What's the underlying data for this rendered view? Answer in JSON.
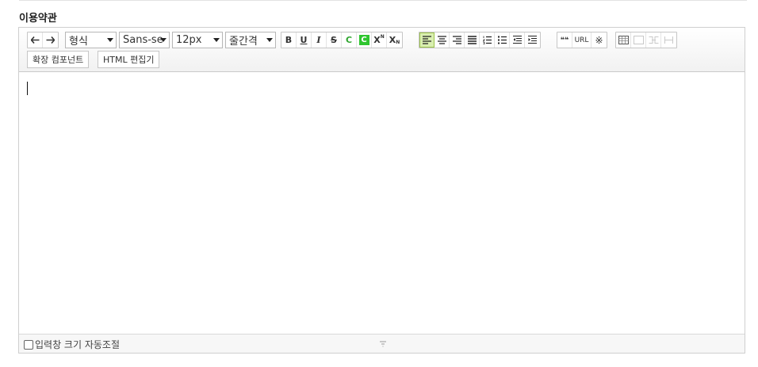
{
  "section": {
    "title": "이용약관"
  },
  "toolbar": {
    "undo_icon": "arrow-left-icon",
    "redo_icon": "arrow-right-icon",
    "format_select": "형식",
    "font_select": "Sans-se",
    "size_select": "12px",
    "lineheight_select": "줄간격",
    "bold": "B",
    "underline": "U",
    "italic": "I",
    "strike": "S",
    "forecolor": "C",
    "backcolor": "C",
    "superscript": "X",
    "superscript_mark": "N",
    "subscript": "X",
    "subscript_mark": "N",
    "quote": "❝❝",
    "url": "URL",
    "special_char": "※",
    "extension_component": "확장 컴포넌트",
    "html_edit": "HTML 편집기"
  },
  "statusbar": {
    "autoresize_label": "입력창 크기 자동조절"
  },
  "colors": {
    "active_bg": "#d9efb0",
    "green": "#2fa52f"
  }
}
